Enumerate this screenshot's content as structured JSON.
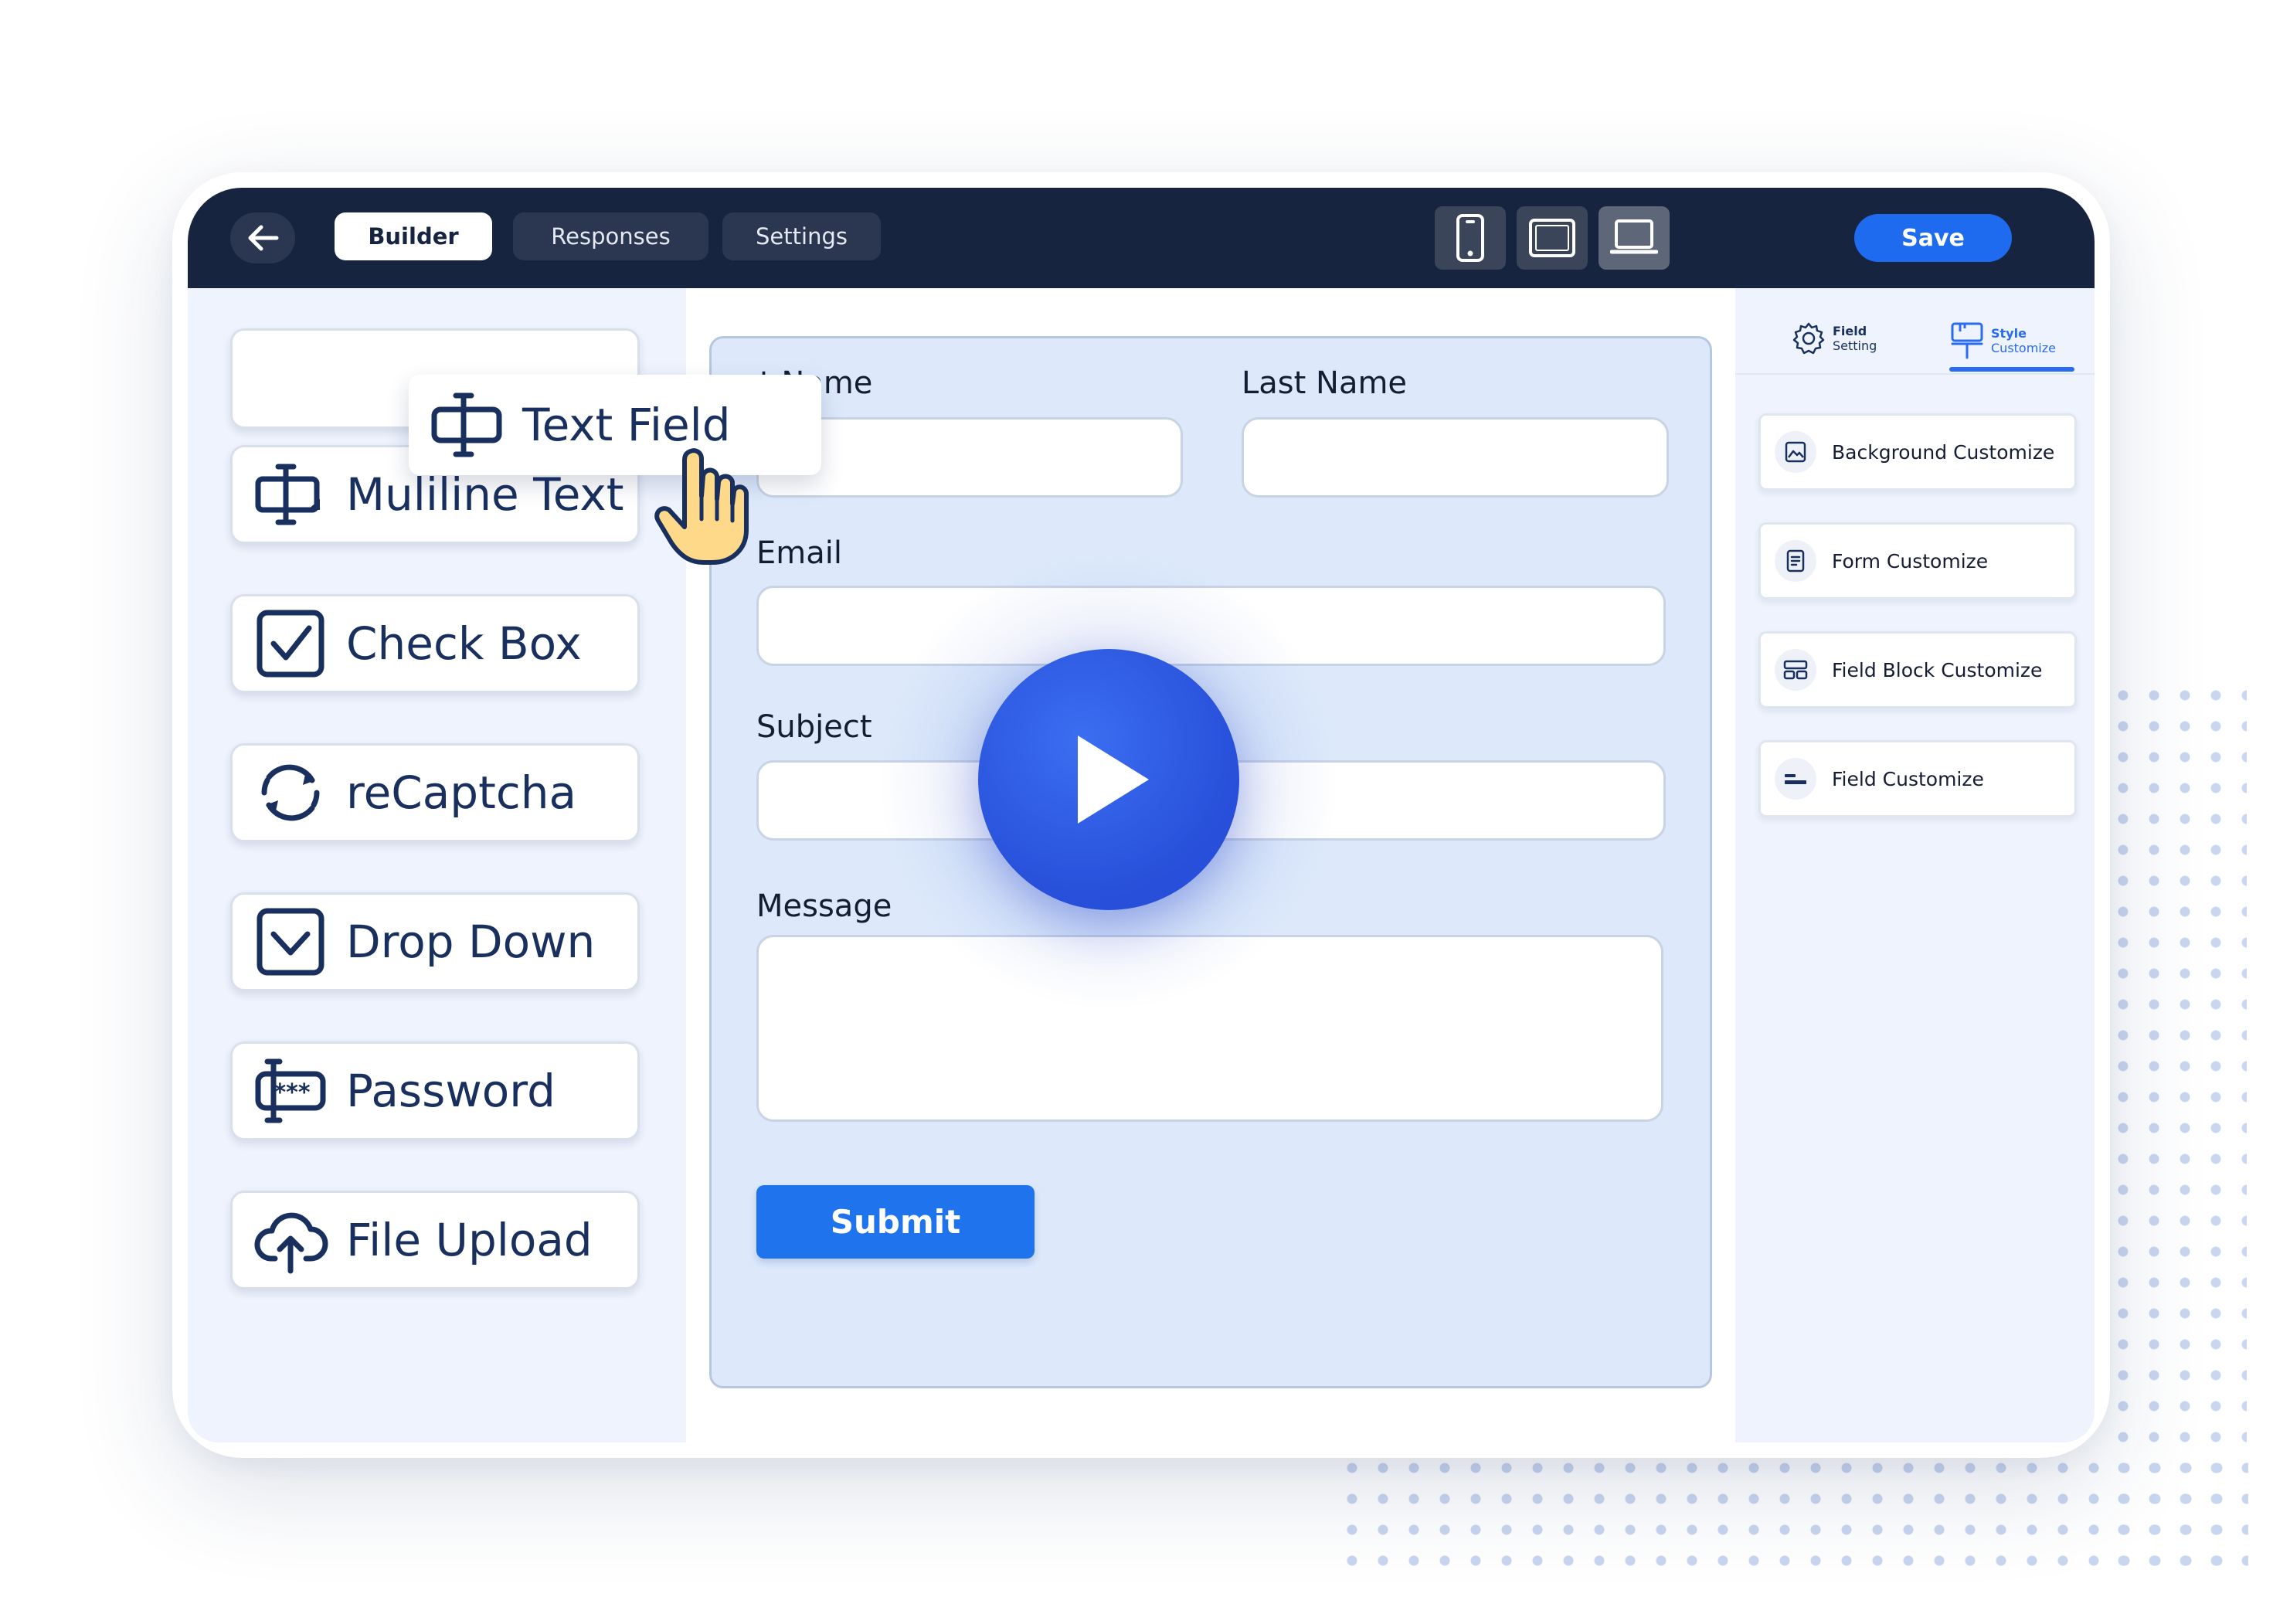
{
  "topbar": {
    "tabs": [
      {
        "label": "Builder",
        "active": true
      },
      {
        "label": "Responses",
        "active": false
      },
      {
        "label": "Settings",
        "active": false
      }
    ],
    "devices": [
      "mobile-icon",
      "tablet-icon",
      "desktop-icon"
    ],
    "active_device": "desktop-icon",
    "save_label": "Save"
  },
  "palette": {
    "dragging": {
      "label": "Text Field",
      "icon": "text-field-icon"
    },
    "items": [
      {
        "label": "Muliline Text",
        "icon": "multiline-text-icon"
      },
      {
        "label": "Check Box",
        "icon": "checkbox-icon"
      },
      {
        "label": "reCaptcha",
        "icon": "recaptcha-icon"
      },
      {
        "label": "Drop Down",
        "icon": "dropdown-icon"
      },
      {
        "label": "Password",
        "icon": "password-icon"
      },
      {
        "label": "File Upload",
        "icon": "upload-icon"
      }
    ]
  },
  "form": {
    "first_name_label": "t Name",
    "last_name_label": "Last Name",
    "email_label": "Email",
    "subject_label": "Subject",
    "message_label": "Message",
    "submit_label": "Submit"
  },
  "right_panel": {
    "tabs": [
      {
        "line1": "Field",
        "line2": "Setting",
        "icon": "gear-icon",
        "active": false
      },
      {
        "line1": "Style",
        "line2": "Customize",
        "icon": "paint-roller-icon",
        "active": true
      }
    ],
    "options": [
      {
        "label": "Background Customize",
        "icon": "image-icon"
      },
      {
        "label": "Form Customize",
        "icon": "document-icon"
      },
      {
        "label": "Field Block Customize",
        "icon": "blocks-icon"
      },
      {
        "label": "Field Customize",
        "icon": "field-line-icon"
      }
    ]
  },
  "colors": {
    "topbar": "#162440",
    "accent": "#1f6bf0",
    "play": "#2a55e0",
    "panel": "#eef3fd",
    "form_bg": "#dde9fb"
  }
}
